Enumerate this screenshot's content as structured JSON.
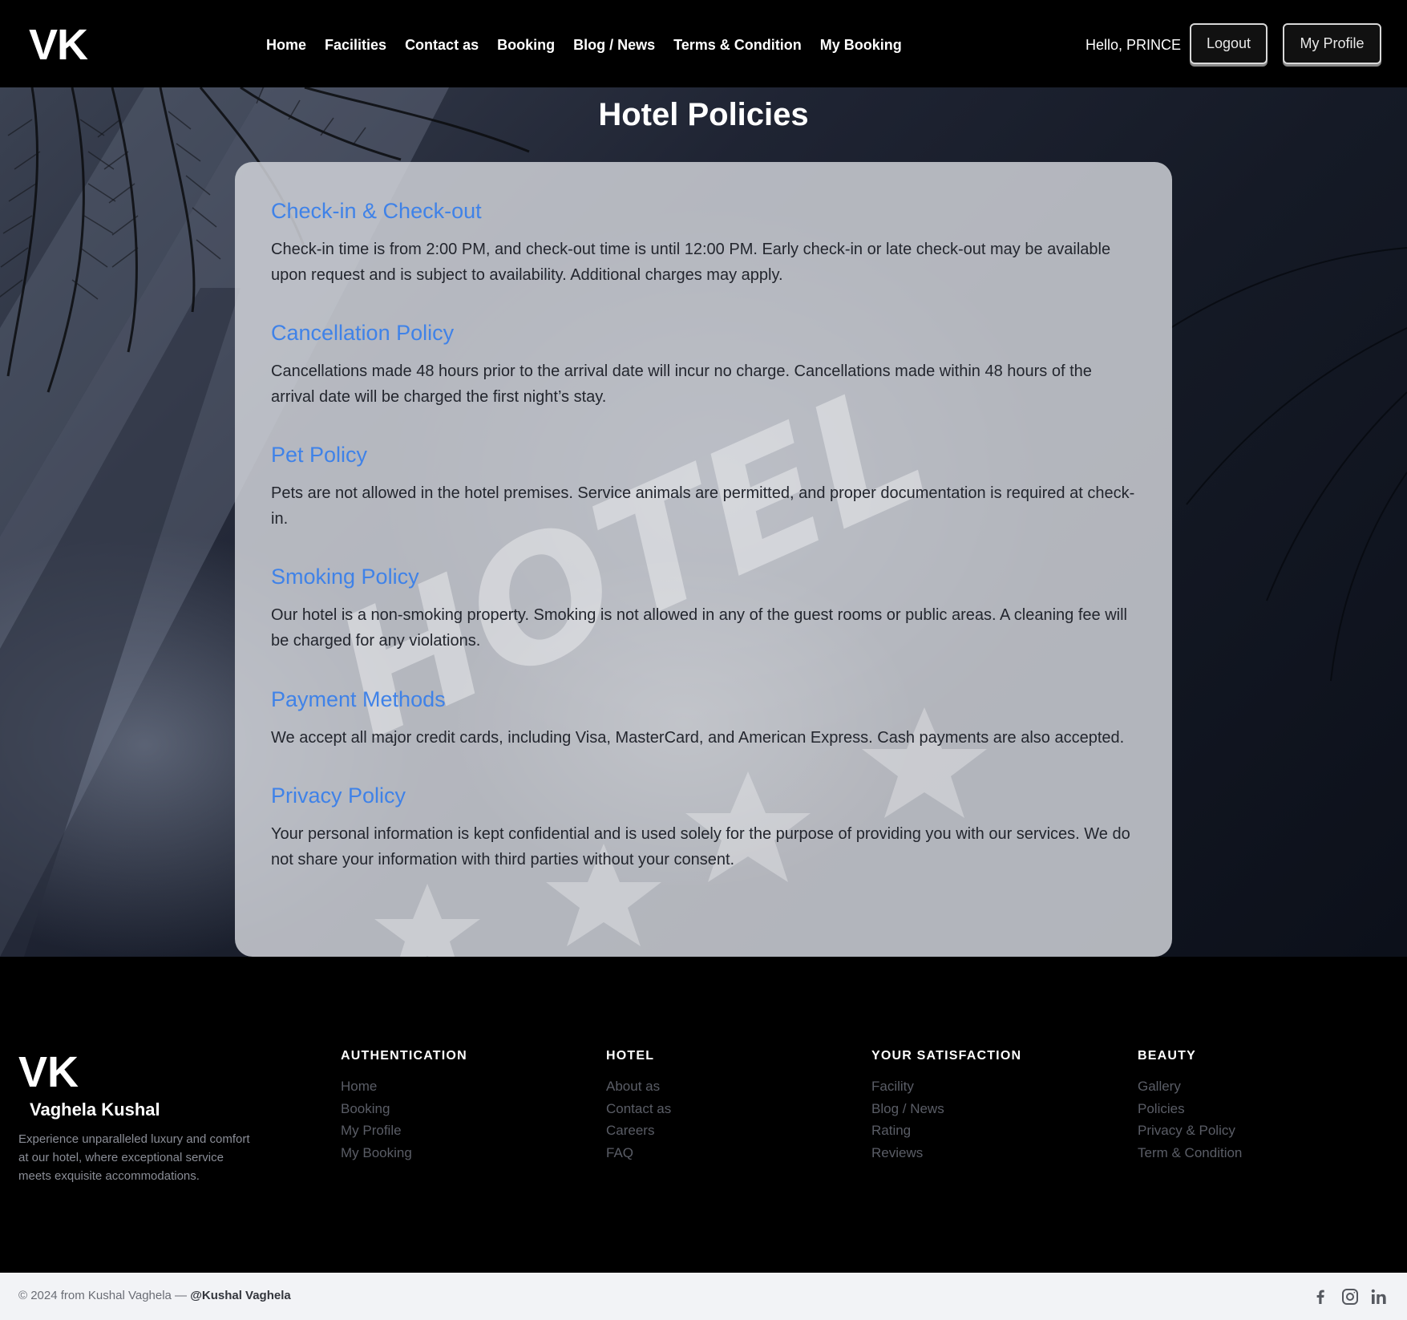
{
  "navbar": {
    "brand": "VK",
    "links": [
      "Home",
      "Facilities",
      "Contact as",
      "Booking",
      "Blog / News",
      "Terms & Condition",
      "My Booking"
    ],
    "greeting": "Hello, PRINCE",
    "logout_label": "Logout",
    "profile_label": "My Profile"
  },
  "main": {
    "title": "Hotel Policies",
    "policies": [
      {
        "heading": "Check-in & Check-out",
        "text": "Check-in time is from 2:00 PM, and check-out time is until 12:00 PM. Early check-in or late check-out may be available upon request and is subject to availability. Additional charges may apply."
      },
      {
        "heading": "Cancellation Policy",
        "text": "Cancellations made 48 hours prior to the arrival date will incur no charge. Cancellations made within 48 hours of the arrival date will be charged the first night’s stay."
      },
      {
        "heading": "Pet Policy",
        "text": "Pets are not allowed in the hotel premises. Service animals are permitted, and proper documentation is required at check-in."
      },
      {
        "heading": "Smoking Policy",
        "text": "Our hotel is a non-smoking property. Smoking is not allowed in any of the guest rooms or public areas. A cleaning fee will be charged for any violations."
      },
      {
        "heading": "Payment Methods",
        "text": "We accept all major credit cards, including Visa, MasterCard, and American Express. Cash payments are also accepted."
      },
      {
        "heading": "Privacy Policy",
        "text": "Your personal information is kept confidential and is used solely for the purpose of providing you with our services. We do not share your information with third parties without your consent."
      }
    ]
  },
  "footer": {
    "brand": "VK",
    "name": "Vaghela Kushal",
    "description": "Experience unparalleled luxury and comfort at our hotel, where exceptional service meets exquisite accommodations.",
    "columns": [
      {
        "title": "AUTHENTICATION",
        "links": [
          "Home",
          "Booking",
          "My Profile",
          "My Booking"
        ]
      },
      {
        "title": "HOTEL",
        "links": [
          "About as",
          "Contact as",
          "Careers",
          "FAQ"
        ]
      },
      {
        "title": "YOUR SATISFACTION",
        "links": [
          "Facility",
          "Blog / News",
          "Rating",
          "Reviews"
        ]
      },
      {
        "title": "BEAUTY",
        "links": [
          "Gallery",
          "Policies",
          "Privacy & Policy",
          "Term & Condition"
        ]
      }
    ],
    "copyright_prefix": "© 2024 from Kushal Vaghela — ",
    "copyright_handle": "@Kushal Vaghela",
    "social_icons": [
      "facebook-icon",
      "instagram-icon",
      "linkedin-icon"
    ]
  },
  "colors": {
    "accent": "#3f82e8",
    "nav_bg": "#000000",
    "footer_bg": "#000000",
    "bottom_bar_bg": "#f2f3f6"
  }
}
